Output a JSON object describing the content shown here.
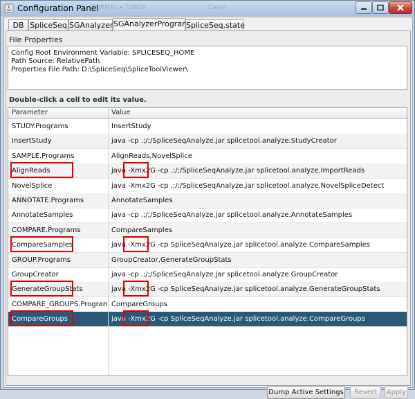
{
  "window": {
    "title": "Configuration Panel",
    "title_ghost_1": "NORMAL ▸ TUBER",
    "title_ghost_2": "Carre"
  },
  "tabs": [
    {
      "label": "DB"
    },
    {
      "label": "SpliceSeq"
    },
    {
      "label": "SGAnalyzer"
    },
    {
      "label": "SGAnalyzerPrograms",
      "active": true
    },
    {
      "label": "SpliceSeq.state"
    }
  ],
  "file_properties": {
    "title": "File Properties",
    "line1": "Config Root Environment Variable: SPLICESEQ_HOME",
    "line2": "Path Source: RelativePath",
    "line3": "Properties File Path: D:\\SpliceSeq\\SpliceToolViewer\\"
  },
  "hint": "Double-click a cell to edit its value.",
  "table": {
    "headers": {
      "parameter": "Parameter",
      "value": "Value"
    },
    "rows": [
      {
        "parameter": "STUDY.Programs",
        "value": "InsertStudy"
      },
      {
        "parameter": "InsertStudy",
        "value": "java -cp .;/;/SpliceSeqAnalyze.jar splicetool.analyze.StudyCreator"
      },
      {
        "parameter": "SAMPLE.Programs",
        "value": "AlignReads,NovelSplice"
      },
      {
        "parameter": "AlignReads",
        "value": "java -Xmx2G -cp .;/;/SpliceSeqAnalyze.jar splicetool.analyze.ImportReads",
        "highlighted": true
      },
      {
        "parameter": "NovelSplice",
        "value": "java -Xmx2G -cp .;/;/SpliceSeqAnalyze.jar splicetool.analyze.NovelSpliceDetect"
      },
      {
        "parameter": "ANNOTATE.Programs",
        "value": "AnnotateSamples"
      },
      {
        "parameter": "AnnotateSamples",
        "value": "java -cp .;/;/SpliceSeqAnalyze.jar splicetool.analyze.AnnotateSamples"
      },
      {
        "parameter": "COMPARE.Programs",
        "value": "CompareSamples"
      },
      {
        "parameter": "CompareSamples",
        "value": "java -Xmx2G -cp SpliceSeqAnalyze.jar splicetool.analyze.CompareSamples",
        "highlighted": true
      },
      {
        "parameter": "GROUP.Programs",
        "value": "GroupCreator,GenerateGroupStats"
      },
      {
        "parameter": "GroupCreator",
        "value": "java -cp .;/;/SpliceSeqAnalyze.jar splicetool.analyze.GroupCreator"
      },
      {
        "parameter": "GenerateGroupStats",
        "value": "java -Xmx2G -cp SpliceSeqAnalyze.jar splicetool.analyze.GenerateGroupStats",
        "highlighted": true
      },
      {
        "parameter": "COMPARE_GROUPS.Programs",
        "value": "CompareGroups"
      },
      {
        "parameter": "CompareGroups",
        "value": "java -Xmx2G -cp SpliceSeqAnalyze.jar splicetool.analyze.CompareGroups",
        "highlighted": true,
        "selected": true
      }
    ]
  },
  "buttons": {
    "dump": "Dump Active Settings",
    "revert": "Revert",
    "apply": "Apply"
  },
  "colors": {
    "selection": "#2b5877",
    "annotation_box": "#e00000"
  }
}
